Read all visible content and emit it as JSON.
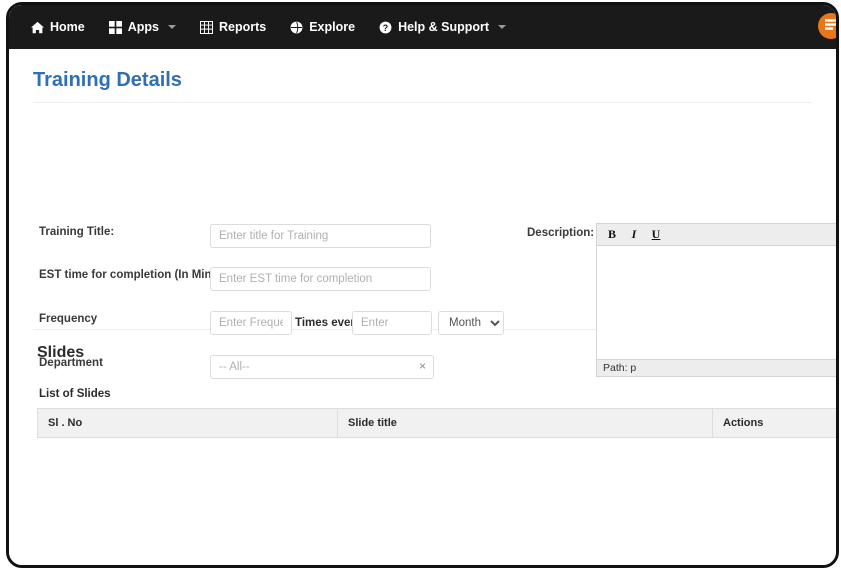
{
  "navbar": {
    "items": [
      {
        "label": "Home",
        "icon": "home-icon",
        "caret": false
      },
      {
        "label": "Apps",
        "icon": "grid-icon",
        "caret": true
      },
      {
        "label": "Reports",
        "icon": "table-icon",
        "caret": false
      },
      {
        "label": "Explore",
        "icon": "globe-icon",
        "caret": false
      },
      {
        "label": "Help & Support",
        "icon": "question-circle-icon",
        "caret": true
      }
    ],
    "badge": {
      "name": "user-menu-badge",
      "color": "#e8761a",
      "icon": "list-icon"
    },
    "background": "#1a1a1a"
  },
  "page": {
    "title": "Training Details",
    "title_color": "#2f6fb5"
  },
  "form": {
    "training_title": {
      "label": "Training Title:",
      "placeholder": "Enter title for Training",
      "value": ""
    },
    "est_time": {
      "label": "EST time for completion (In Mins):",
      "placeholder": "Enter EST time for completion",
      "value": ""
    },
    "frequency": {
      "label": "Frequency",
      "count_placeholder": "Enter Frequency",
      "count_value": "",
      "middle_label": "Times every",
      "interval_placeholder": "Enter",
      "interval_value": "",
      "period_selected": "Month",
      "period_options": [
        "Month"
      ]
    },
    "department": {
      "label": "Department",
      "value": "-- All--",
      "clear_icon": "×"
    }
  },
  "description": {
    "label": "Description:",
    "toolbar": {
      "bold": "B",
      "italic": "I",
      "underline": "U"
    },
    "content": "",
    "status": "Path: p"
  },
  "slides": {
    "heading": "Slides",
    "list_label": "List of Slides",
    "columns": [
      "Sl . No",
      "Slide title",
      "Actions"
    ],
    "rows": []
  }
}
